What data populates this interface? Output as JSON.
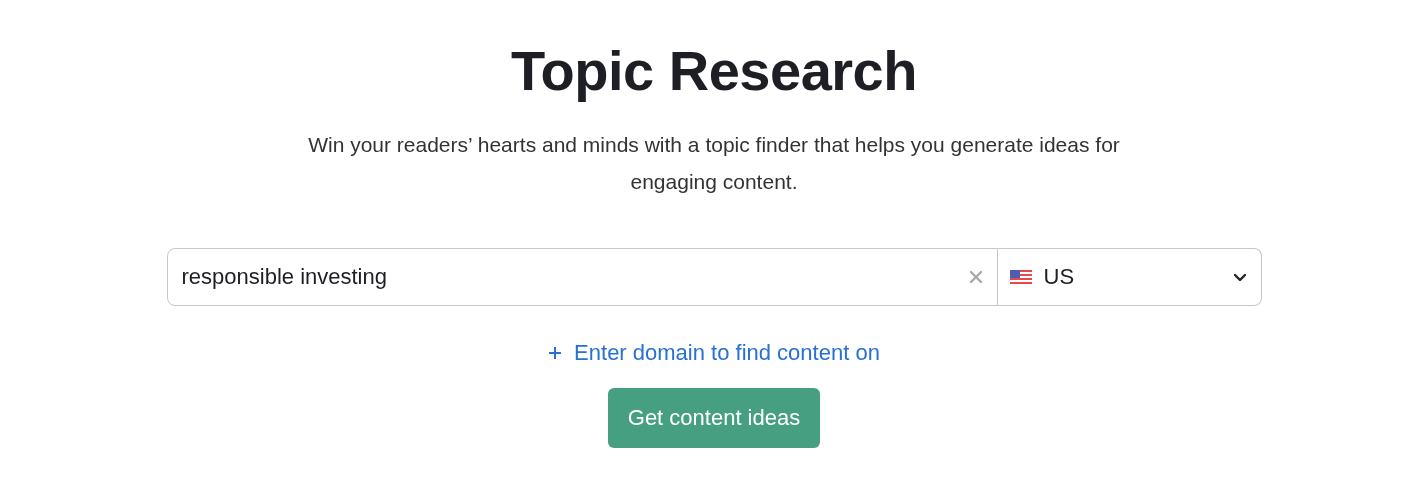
{
  "title": "Topic Research",
  "subtitle": "Win your readers’ hearts and minds with a topic finder that helps you generate ideas for engaging content.",
  "search": {
    "value": "responsible investing"
  },
  "country": {
    "value": "US"
  },
  "domain_link": "Enter domain to find content on",
  "submit_button": "Get content ideas"
}
